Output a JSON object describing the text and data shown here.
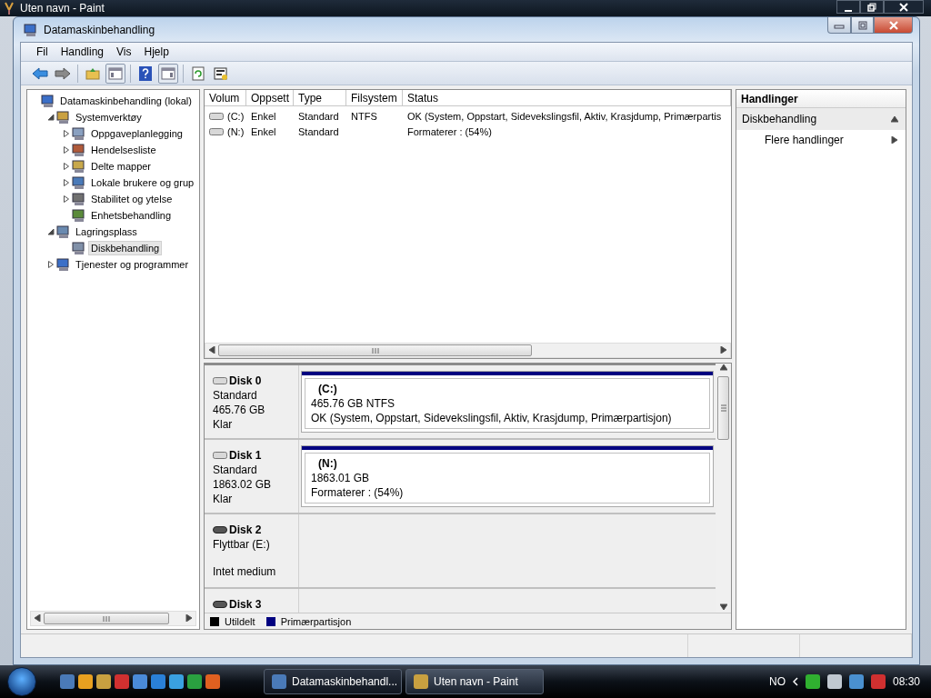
{
  "paint_window": {
    "title": "Uten navn - Paint"
  },
  "window": {
    "title": "Datamaskinbehandling"
  },
  "menu": [
    "Fil",
    "Handling",
    "Vis",
    "Hjelp"
  ],
  "tree": [
    {
      "label": "Datamaskinbehandling (lokal)",
      "selected": false,
      "children": [
        {
          "label": "Systemverktøy",
          "expanded": true,
          "selected": false,
          "children": [
            {
              "label": "Oppgaveplanlegging",
              "expanded": false,
              "selected": false
            },
            {
              "label": "Hendelsesliste",
              "expanded": false,
              "selected": false
            },
            {
              "label": "Delte mapper",
              "expanded": false,
              "selected": false
            },
            {
              "label": "Lokale brukere og grup",
              "expanded": false,
              "selected": false
            },
            {
              "label": "Stabilitet og ytelse",
              "expanded": false,
              "selected": false
            },
            {
              "label": "Enhetsbehandling",
              "selected": false
            }
          ]
        },
        {
          "label": "Lagringsplass",
          "expanded": true,
          "selected": false,
          "children": [
            {
              "label": "Diskbehandling",
              "selected": true
            }
          ]
        },
        {
          "label": "Tjenester og programmer",
          "expanded": false,
          "selected": false
        }
      ]
    }
  ],
  "volumes": {
    "columns": [
      "Volum",
      "Oppsett",
      "Type",
      "Filsystem",
      "Status"
    ],
    "rows": [
      {
        "volume": "(C:)",
        "layout": "Enkel",
        "type": "Standard",
        "filesystem": "NTFS",
        "status": "OK (System, Oppstart, Sidevekslingsfil, Aktiv, Krasjdump, Primærpartis"
      },
      {
        "volume": "(N:)",
        "layout": "Enkel",
        "type": "Standard",
        "status": "Formaterer : (54%)"
      }
    ]
  },
  "disks": [
    {
      "name": "Disk 0",
      "kind": "fixed",
      "lines": [
        "Standard",
        "465.76 GB",
        "Klar"
      ],
      "partition": {
        "label": "(C:)",
        "size": "465.76 GB NTFS",
        "status": "OK (System, Oppstart, Sidevekslingsfil, Aktiv, Krasjdump, Primærpartisjon)"
      }
    },
    {
      "name": "Disk 1",
      "kind": "fixed",
      "lines": [
        "Standard",
        "1863.02 GB",
        "Klar"
      ],
      "partition": {
        "label": "(N:)",
        "size": "1863.01 GB",
        "status": "Formaterer : (54%)"
      }
    },
    {
      "name": "Disk 2",
      "kind": "removable",
      "lines": [
        "Flyttbar (E:)",
        "Intet medium"
      ]
    },
    {
      "name": "Disk 3",
      "kind": "removable"
    }
  ],
  "legend": [
    {
      "label": "Utildelt",
      "color": "#000000"
    },
    {
      "label": "Primærpartisjon",
      "color": "#000080"
    }
  ],
  "actions": {
    "title": "Handlinger",
    "sections": [
      {
        "label": "Diskbehandling",
        "expanded": true,
        "items": [
          "Flere handlinger"
        ]
      }
    ]
  },
  "taskbar": {
    "tasks": [
      {
        "label": "Datamaskinbehandl...",
        "selected": true
      },
      {
        "label": "Uten navn - Paint",
        "selected": false
      }
    ],
    "language": "NO",
    "time": "08:30"
  }
}
